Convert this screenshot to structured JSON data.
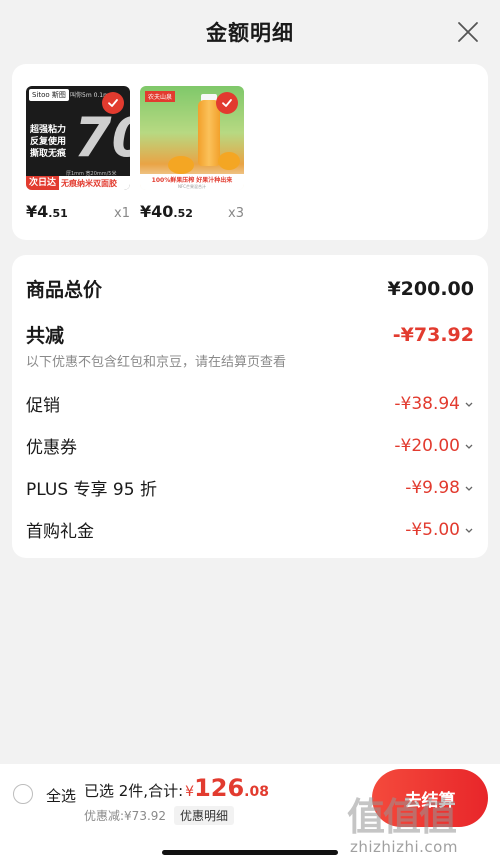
{
  "header": {
    "title": "金额明细"
  },
  "products": [
    {
      "price_int": "¥4",
      "price_dec": ".51",
      "qty": "x1",
      "thumb_brand": "Sitoo 斯图",
      "thumb_brand_right": "叫你5m 0.1mm",
      "thumb_features": [
        "超强粘力",
        "反复使用",
        "撕取无痕"
      ],
      "thumb_big": "70",
      "thumb_spec": "厚1mm 宽20mm/5米",
      "thumb_tag": "次日达",
      "thumb_banner": "无痕纳米双面胶"
    },
    {
      "price_int": "¥40",
      "price_dec": ".52",
      "qty": "x3",
      "thumb_brand": "农夫山泉",
      "thumb_line1": "100%鲜果压榨 好果汁种出来",
      "thumb_line2": "NFC芒果混合汁"
    }
  ],
  "summary": {
    "total_label": "商品总价",
    "total_value": "¥200.00",
    "reduce_label": "共减",
    "reduce_value": "-¥73.92",
    "note": "以下优惠不包含红包和京豆，请在结算页查看",
    "items": [
      {
        "label": "促销",
        "value": "-¥38.94"
      },
      {
        "label": "优惠券",
        "value": "-¥20.00"
      },
      {
        "label": "PLUS 专享 95 折",
        "value": "-¥9.98"
      },
      {
        "label": "首购礼金",
        "value": "-¥5.00"
      }
    ]
  },
  "bottom": {
    "select_all": "全选",
    "selected_text": "已选 2件,合计:",
    "currency": "¥",
    "amount_int": "126",
    "amount_dec": ".08",
    "discount_text": "优惠减:¥73.92",
    "detail_label": "优惠明细",
    "checkout_label": "去结算"
  },
  "watermark": {
    "text": "值值值",
    "url": "zhizhizhi.com"
  },
  "colors": {
    "accent": "#e23b2f",
    "background": "#f2f2f2"
  }
}
